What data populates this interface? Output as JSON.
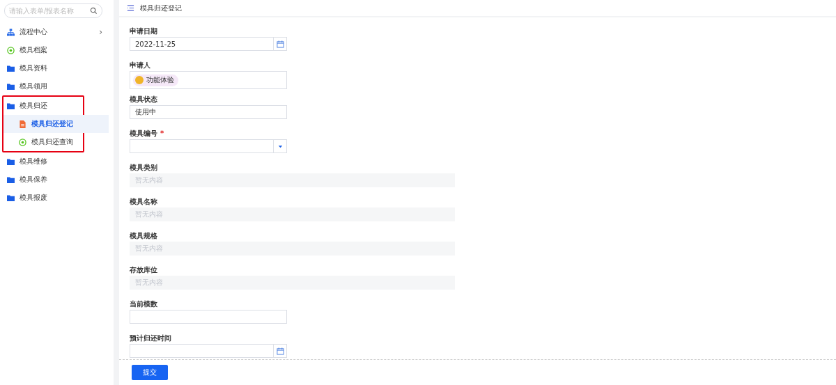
{
  "sidebar": {
    "search": {
      "placeholder": "请输入表单/报表名称"
    },
    "items": [
      {
        "label": "流程中心",
        "kind": "org",
        "arrow": "›",
        "selected": false
      },
      {
        "label": "模具档案",
        "kind": "target",
        "selected": false
      },
      {
        "label": "模具资料",
        "kind": "folder",
        "selected": false
      },
      {
        "label": "模具领用",
        "kind": "folder",
        "selected": false
      },
      {
        "label": "模具归还",
        "kind": "folder",
        "selected": false,
        "highlighted": true,
        "children": [
          {
            "label": "模具归还登记",
            "kind": "doc",
            "selected": true
          },
          {
            "label": "模具归还查询",
            "kind": "target",
            "selected": false
          }
        ]
      },
      {
        "label": "模具维修",
        "kind": "folder",
        "selected": false
      },
      {
        "label": "模具保养",
        "kind": "folder",
        "selected": false
      },
      {
        "label": "模具报废",
        "kind": "folder",
        "selected": false
      }
    ]
  },
  "header": {
    "title": "模具归还登记"
  },
  "form": {
    "fields": [
      {
        "label": "申请日期",
        "kind": "date",
        "value": "2022-11-25"
      },
      {
        "label": "申请人",
        "kind": "user",
        "value": "功能体验"
      },
      {
        "label": "模具状态",
        "kind": "text",
        "value": "使用中"
      },
      {
        "label": "模具编号",
        "kind": "select",
        "required_mark": "*"
      },
      {
        "label": "模具类别",
        "kind": "readonly",
        "placeholder": "暂无内容"
      },
      {
        "label": "模具名称",
        "kind": "readonly",
        "placeholder": "暂无内容"
      },
      {
        "label": "模具规格",
        "kind": "readonly",
        "placeholder": "暂无内容"
      },
      {
        "label": "存放库位",
        "kind": "readonly",
        "placeholder": "暂无内容"
      },
      {
        "label": "当前模数",
        "kind": "text"
      },
      {
        "label": "预计归还时间",
        "kind": "date"
      }
    ]
  },
  "footer": {
    "submit": "提交"
  }
}
